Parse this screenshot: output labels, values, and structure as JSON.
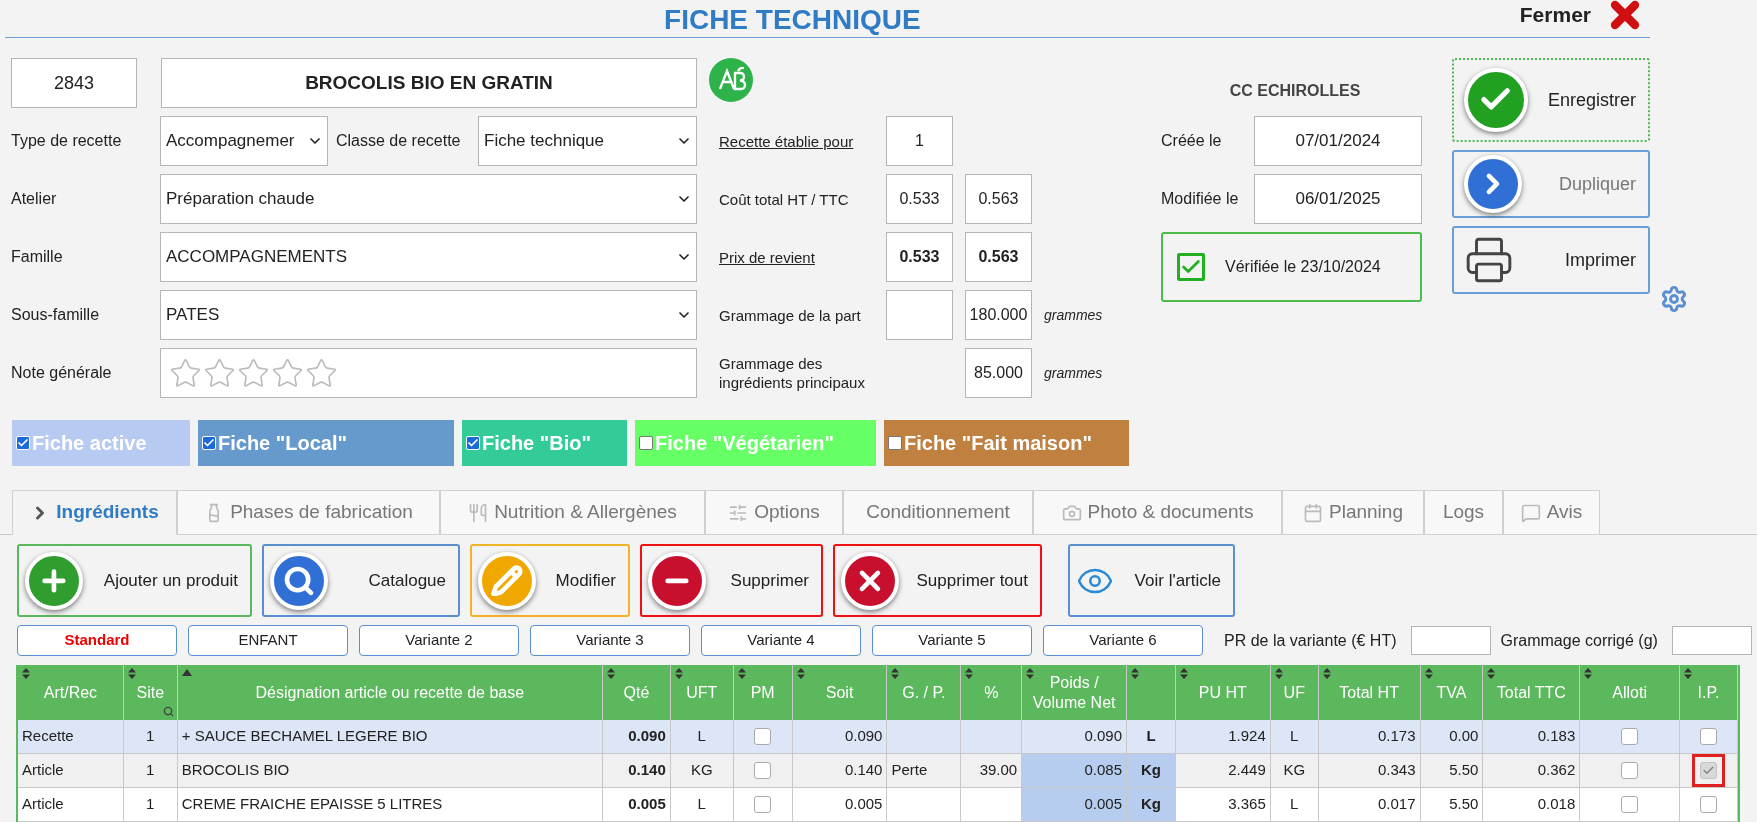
{
  "header": {
    "title": "FICHE TECHNIQUE",
    "close_label": "Fermer"
  },
  "recipe": {
    "number": "2843",
    "name": "BROCOLIS BIO EN GRATIN"
  },
  "type_recette": {
    "label": "Type de recette",
    "value": "Accompagnemer"
  },
  "classe_recette": {
    "label": "Classe de recette",
    "value": "Fiche technique"
  },
  "selects": [
    {
      "label": "Atelier",
      "value": "Préparation chaude"
    },
    {
      "label": "Famille",
      "value": "ACCOMPAGNEMENTS"
    },
    {
      "label": "Sous-famille",
      "value": "PATES"
    }
  ],
  "note": {
    "label": "Note générale",
    "stars": 0
  },
  "costs": [
    {
      "kind": "single",
      "label": "Recette établie pour",
      "link": true,
      "bold": false,
      "ht": "1"
    },
    {
      "kind": "pair",
      "label": "Coût total HT / TTC",
      "link": false,
      "bold": false,
      "ht": "0.533",
      "ttc": "0.563"
    },
    {
      "kind": "pair",
      "label": "Prix de revient",
      "link": true,
      "bold": true,
      "ht": "0.533",
      "ttc": "0.563"
    },
    {
      "kind": "pair",
      "label": "Grammage de la part",
      "link": false,
      "bold": false,
      "ttc": "180.000",
      "unit": "grammes"
    },
    {
      "kind": "second",
      "label": "Grammage des ingrédients principaux",
      "link": false,
      "bold": false,
      "ttc": "85.000",
      "unit": "grammes"
    }
  ],
  "site": "CC ECHIROLLES",
  "dates": [
    {
      "label": "Créée le",
      "value": "07/01/2024"
    },
    {
      "label": "Modifiée le",
      "value": "06/01/2025"
    }
  ],
  "verification": {
    "label": "Vérifiée le 23/10/2024",
    "checked": true
  },
  "buttons": [
    {
      "label": "Enregistrer",
      "disabled": false
    },
    {
      "label": "Dupliquer",
      "disabled": true
    },
    {
      "label": "Imprimer",
      "disabled": false
    }
  ],
  "flags": [
    {
      "label": "Fiche active",
      "checked": true,
      "color": "#b7caf1"
    },
    {
      "label": "Fiche \"Local\"",
      "checked": true,
      "color": "#6699cc"
    },
    {
      "label": "Fiche \"Bio\"",
      "checked": true,
      "color": "#33cc99"
    },
    {
      "label": "Fiche \"Végétarien\"",
      "checked": false,
      "color": "#66ff66"
    },
    {
      "label": "Fiche \"Fait maison\"",
      "checked": false,
      "color": "#c08040"
    }
  ],
  "tabs": [
    {
      "label": "Ingrédients",
      "selected": true
    },
    {
      "label": "Phases de fabrication",
      "selected": false
    },
    {
      "label": "Nutrition & Allergènes",
      "selected": false
    },
    {
      "label": "Options",
      "selected": false
    },
    {
      "label": "Conditionnement",
      "selected": false
    },
    {
      "label": "Photo & documents",
      "selected": false
    },
    {
      "label": "Planning",
      "selected": false
    },
    {
      "label": "Logs",
      "selected": false
    },
    {
      "label": "Avis",
      "selected": false
    }
  ],
  "actions": [
    {
      "label": "Ajouter un produit",
      "color": "#5cb85c"
    },
    {
      "label": "Catalogue",
      "color": "#5b8fd0"
    },
    {
      "label": "Modifier",
      "color": "#f0b429"
    },
    {
      "label": "Supprimer",
      "color": "#ee1111"
    },
    {
      "label": "Supprimer tout",
      "color": "#ee1111"
    },
    {
      "label": "Voir l'article",
      "color": "#5b8fd0"
    }
  ],
  "variants": [
    {
      "label": "Standard",
      "selected": true
    },
    {
      "label": "ENFANT",
      "selected": false
    },
    {
      "label": "Variante 2",
      "selected": false
    },
    {
      "label": "Variante 3",
      "selected": false
    },
    {
      "label": "Variante 4",
      "selected": false
    },
    {
      "label": "Variante 5",
      "selected": false
    },
    {
      "label": "Variante 6",
      "selected": false
    }
  ],
  "variant_fields": [
    {
      "label": "PR de la variante (€ HT)"
    },
    {
      "label": "Grammage corrigé (g)"
    }
  ],
  "table": {
    "columns": [
      {
        "label": "Art/Rec",
        "sorted": false
      },
      {
        "label": "Site",
        "sorted": false,
        "filter": true
      },
      {
        "label": "Désignation article ou recette de base",
        "sorted": true
      },
      {
        "label": "Qté",
        "sorted": false
      },
      {
        "label": "UFT",
        "sorted": false
      },
      {
        "label": "PM",
        "sorted": false
      },
      {
        "label": "Soit",
        "sorted": false
      },
      {
        "label": "G. / P.",
        "sorted": false
      },
      {
        "label": "%",
        "sorted": false
      },
      {
        "label": "Poids / Volume Net",
        "sorted": false
      },
      {
        "sorted": false
      },
      {
        "label": "PU HT",
        "sorted": false
      },
      {
        "label": "UF",
        "sorted": false
      },
      {
        "label": "Total HT",
        "sorted": false
      },
      {
        "label": "TVA",
        "sorted": false
      },
      {
        "label": "Total TTC",
        "sorted": false
      },
      {
        "label": "Alloti",
        "sorted": false
      },
      {
        "label": "I.P.",
        "sorted": false
      }
    ],
    "rows": [
      {
        "kind": "recette",
        "selected": true,
        "cells": [
          "Recette",
          "1",
          "+ SAUCE BECHAMEL LEGERE BIO",
          "0.090",
          "L",
          {
            "checked": false
          },
          "0.090",
          null,
          null,
          "0.090",
          "L",
          "1.924",
          "L",
          "0.173",
          "0.00",
          "0.183",
          {
            "checked": false
          },
          {
            "checked": false,
            "disabled": false,
            "flagged": false
          }
        ]
      },
      {
        "kind": "article",
        "selected": false,
        "cells": [
          "Article",
          "1",
          "BROCOLIS BIO",
          "0.140",
          "KG",
          {
            "checked": false
          },
          "0.140",
          "Perte",
          "39.00",
          "0.085",
          "Kg",
          "2.449",
          "KG",
          "0.343",
          "5.50",
          "0.362",
          {
            "checked": false
          },
          {
            "checked": true,
            "disabled": true,
            "flagged": true
          }
        ]
      },
      {
        "kind": "article",
        "selected": false,
        "cells": [
          "Article",
          "1",
          "CREME FRAICHE EPAISSE 5 LITRES",
          "0.005",
          "L",
          {
            "checked": false
          },
          "0.005",
          null,
          null,
          "0.005",
          "Kg",
          "3.365",
          "L",
          "0.017",
          "5.50",
          "0.018",
          {
            "checked": false
          },
          {
            "checked": false,
            "disabled": false,
            "flagged": false
          }
        ]
      }
    ]
  }
}
